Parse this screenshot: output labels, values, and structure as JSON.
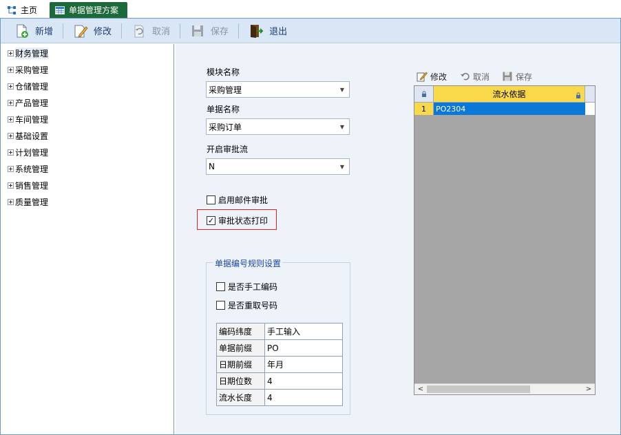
{
  "tabs": [
    {
      "label": "主页",
      "icon": "tree-icon"
    },
    {
      "label": "单据管理方案",
      "icon": "table-icon"
    }
  ],
  "toolbar": {
    "new_label": "新增",
    "edit_label": "修改",
    "cancel_label": "取消",
    "save_label": "保存",
    "exit_label": "退出"
  },
  "tree": {
    "items": [
      {
        "label": "财务管理"
      },
      {
        "label": "采购管理"
      },
      {
        "label": "仓储管理"
      },
      {
        "label": "产品管理"
      },
      {
        "label": "车间管理"
      },
      {
        "label": "基础设置"
      },
      {
        "label": "计划管理"
      },
      {
        "label": "系统管理"
      },
      {
        "label": "销售管理"
      },
      {
        "label": "质量管理"
      }
    ]
  },
  "form": {
    "module_label": "模块名称",
    "module_value": "采购管理",
    "doc_label": "单据名称",
    "doc_value": "采购订单",
    "approval_label": "开启审批流",
    "approval_value": "N",
    "email_approval_label": "启用邮件审批",
    "email_approval_checked": false,
    "status_print_label": "审批状态打印",
    "status_print_checked": true,
    "status_print_checkmark": "✓"
  },
  "rules": {
    "title": "单据编号规则设置",
    "manual_label": "是否手工编码",
    "manual_checked": false,
    "refetch_label": "是否重取号码",
    "refetch_checked": false,
    "rows": [
      {
        "key": "编码纬度",
        "value": "手工输入"
      },
      {
        "key": "单据前缀",
        "value": "PO"
      },
      {
        "key": "日期前缀",
        "value": "年月"
      },
      {
        "key": "日期位数",
        "value": "4"
      },
      {
        "key": "流水长度",
        "value": "4"
      }
    ]
  },
  "grid": {
    "edit_label": "修改",
    "cancel_label": "取消",
    "save_label": "保存",
    "column_header": "流水依据",
    "rows": [
      {
        "num": "1",
        "value": "PO2304"
      }
    ]
  },
  "colors": {
    "active_tab": "#1c6a3a",
    "toolbar_bg": "#d8e6f6",
    "panel_bg": "#eef3fa",
    "grid_header": "#f9d94a",
    "selected_cell": "#0a78d6",
    "highlight_border": "#dd2222"
  }
}
